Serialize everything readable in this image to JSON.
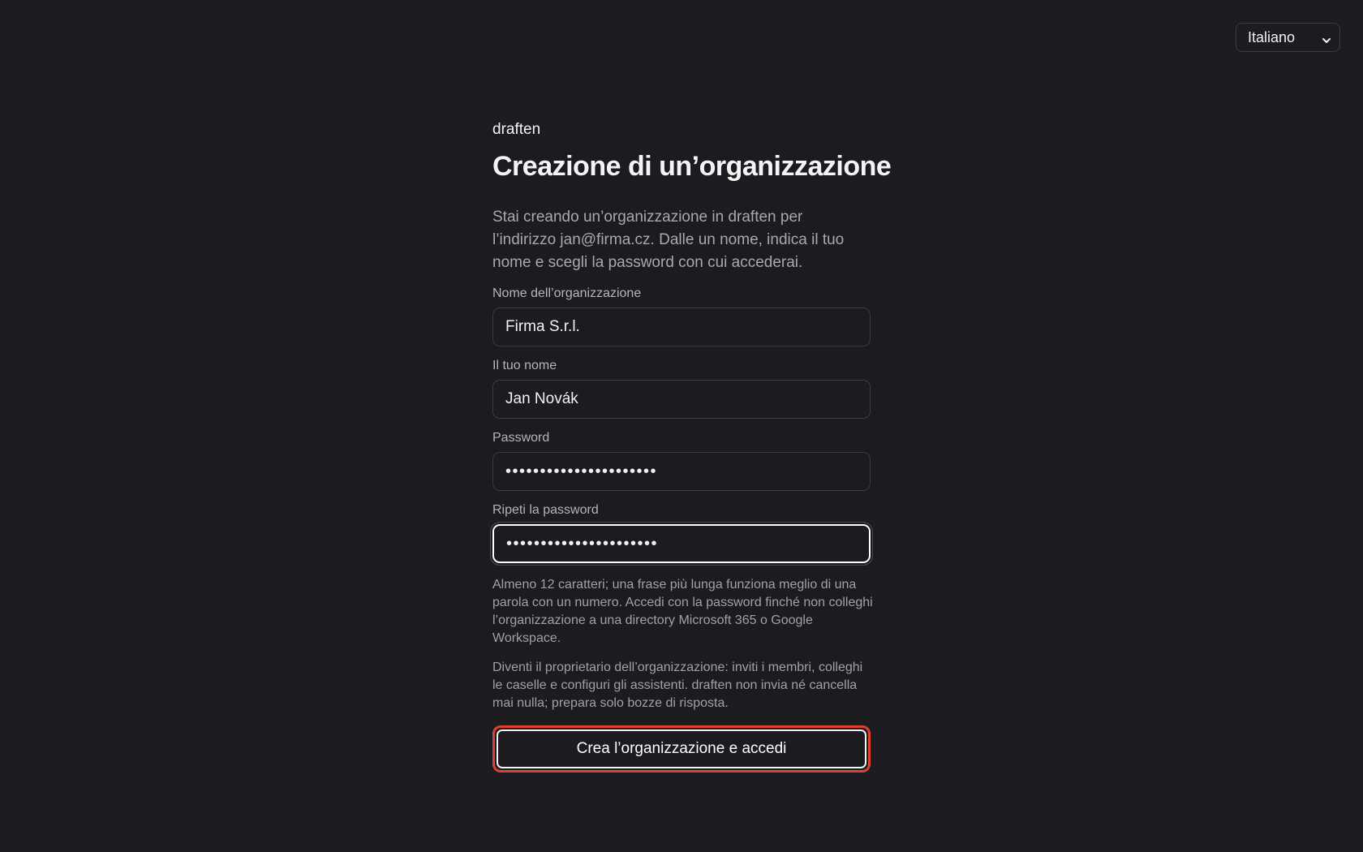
{
  "language": {
    "selected": "Italiano",
    "icon": "chevron-down-icon"
  },
  "brand": "draften",
  "title": "Creazione di un’organizzazione",
  "intro": "Stai creando un’organizzazione in draften per l’indirizzo jan@firma.cz. Dalle un nome, indica il tuo nome e scegli la password con cui accederai.",
  "fields": {
    "org_name": {
      "label": "Nome dell’organizzazione",
      "value": "Firma S.r.l."
    },
    "your_name": {
      "label": "Il tuo nome",
      "value": "Jan Novák"
    },
    "password": {
      "label": "Password",
      "value": "••••••••••••••••••••••"
    },
    "repeat_password": {
      "label": "Ripeti la password",
      "value": "••••••••••••••••••••••"
    }
  },
  "hint_password": "Almeno 12 caratteri; una frase più lunga funziona meglio di una parola con un numero. Accedi con la password finché non colleghi l’organizzazione a una directory Microsoft 365 o Google Workspace.",
  "hint_owner": "Diventi il proprietario dell’organizzazione: inviti i membri, colleghi le caselle e configuri gli assistenti. draften non invia né cancella mai nulla; prepara solo bozze di risposta.",
  "submit_label": "Crea l’organizzazione e accedi",
  "colors": {
    "background": "#1c1c20",
    "accent_ring": "#e0412f",
    "text": "#f2f2f4",
    "muted_text": "#a8a8b0"
  }
}
